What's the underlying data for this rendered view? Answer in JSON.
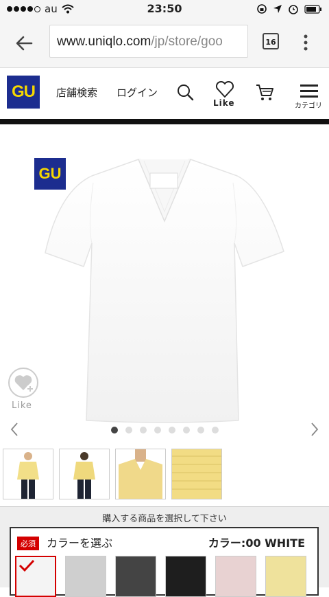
{
  "status_bar": {
    "carrier": "au",
    "time": "23:50"
  },
  "browser": {
    "url_host": "www.uniqlo.com",
    "url_path": "/jp/store/goo",
    "tab_count": "16"
  },
  "header": {
    "logo": "GU",
    "store_search": "店舗検索",
    "login": "ログイン",
    "like_label": "Like",
    "category_label": "カテゴリ"
  },
  "product": {
    "badge": "GU",
    "like_label": "Like",
    "image_count": 8,
    "active_image": 0
  },
  "thumbnails": [
    {
      "name": "model-front"
    },
    {
      "name": "model-back"
    },
    {
      "name": "model-closeup"
    },
    {
      "name": "fabric-detail"
    }
  ],
  "selection": {
    "note": "購入する商品を選択して下さい",
    "required_badge": "必須",
    "color_title": "カラーを選ぶ",
    "color_value": "カラー:00 WHITE",
    "swatches": [
      {
        "color": "#f4f4f4",
        "selected": true
      },
      {
        "color": "#cfcfcf",
        "selected": false
      },
      {
        "color": "#444444",
        "selected": false
      },
      {
        "color": "#1e1e1e",
        "selected": false
      },
      {
        "color": "#e8d2d2",
        "selected": false
      },
      {
        "color": "#efe29c",
        "selected": false
      }
    ]
  }
}
